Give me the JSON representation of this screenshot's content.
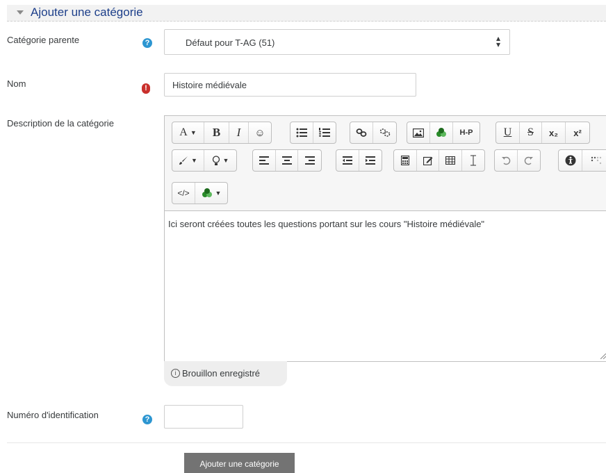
{
  "section": {
    "title": "Ajouter une catégorie"
  },
  "fields": {
    "parent": {
      "label": "Catégorie parente",
      "value": "Défaut pour T-AG (51)",
      "help": "?"
    },
    "name": {
      "label": "Nom",
      "value": "Histoire médiévale",
      "required_mark": "!"
    },
    "description": {
      "label": "Description de la catégorie",
      "content": "Ici seront créées toutes les questions portant sur les cours \"Histoire médiévale\"",
      "draft_status": "Brouillon enregistré",
      "info_glyph": "i"
    },
    "idnumber": {
      "label": "Numéro d'identification",
      "value": "",
      "help": "?"
    }
  },
  "toolbar": {
    "font_btn": "A",
    "bold": "B",
    "italic": "I",
    "emoji": "☺",
    "h5p": "H-P",
    "underline": "U",
    "strike": "S",
    "subscript": "x₂",
    "superscript": "x²",
    "html": "</>"
  },
  "actions": {
    "submit": "Ajouter une catégorie"
  },
  "colors": {
    "accent_blue": "#1d3f8a",
    "help_blue": "#2d96d1",
    "required_red": "#c9302c",
    "button_gray": "#737373"
  }
}
